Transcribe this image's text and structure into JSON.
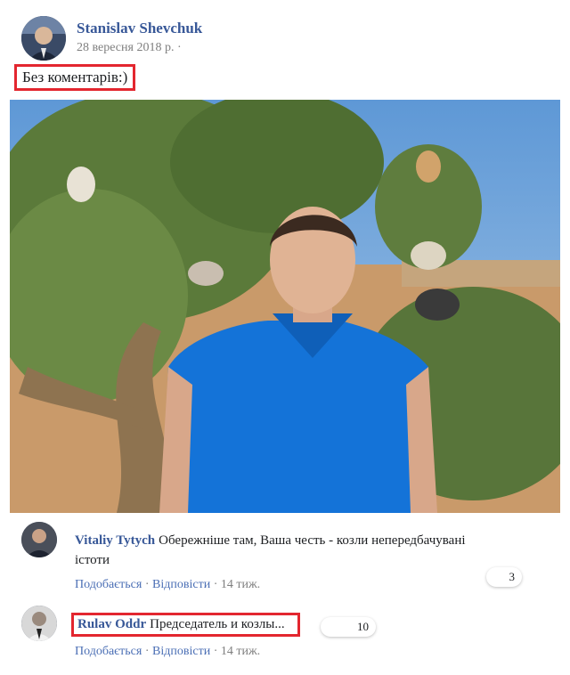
{
  "post": {
    "author": "Stanislav Shevchuk",
    "date": "28 вересня 2018 р. ·",
    "text": "Без коментарів:)"
  },
  "comments": [
    {
      "author": "Vitaliy Tytych",
      "text_line1": "Обережніше там, Ваша честь - козли непередбачувані",
      "text_line2": "істоти",
      "like_label": "Подобається",
      "reply_label": "Відповісти",
      "time": "14 тиж.",
      "reactions": "3"
    },
    {
      "author": "Rulav Oddr",
      "text": "Председатель и козлы...",
      "like_label": "Подобається",
      "reply_label": "Відповісти",
      "time": "14 тиж.",
      "reactions": "10"
    }
  ],
  "icons": {
    "post_avatar": "person-avatar",
    "comment1_avatar": "person-avatar",
    "comment2_avatar": "person-avatar",
    "reaction": "like-reaction-icon"
  },
  "colors": {
    "link": "#385898",
    "highlight": "#e3262f",
    "sky": "#6fa3d8",
    "shirt": "#1473d8"
  }
}
